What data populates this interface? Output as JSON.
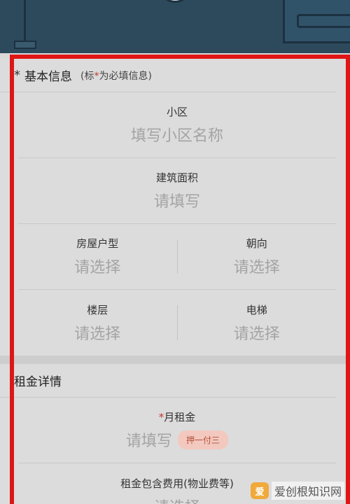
{
  "basic_section": {
    "star": "*",
    "title": "基本信息",
    "hint_prefix": "(标",
    "hint_mark": "*",
    "hint_suffix": "为必填信息)"
  },
  "fields": {
    "community": {
      "label": "小区",
      "placeholder": "填写小区名称"
    },
    "area": {
      "label": "建筑面积",
      "placeholder": "请填写"
    },
    "layout": {
      "label": "房屋户型",
      "placeholder": "请选择"
    },
    "orientation": {
      "label": "朝向",
      "placeholder": "请选择"
    },
    "floor": {
      "label": "楼层",
      "placeholder": "请选择"
    },
    "elevator": {
      "label": "电梯",
      "placeholder": "请选择"
    }
  },
  "rent_section": {
    "title": "租金详情",
    "monthly_rent": {
      "required_mark": "*",
      "label": "月租金",
      "placeholder": "请填写",
      "payment_tag": "押一付三"
    },
    "included_fees": {
      "label": "租金包含费用(物业费等)",
      "placeholder": "请选择"
    }
  },
  "watermark": {
    "logo": "爱",
    "text": "爱创根知识网"
  },
  "colors": {
    "highlight_frame": "#e01515",
    "required": "#c0392b",
    "tag_bg": "#f2c8bf",
    "tag_text": "#b4503a"
  }
}
